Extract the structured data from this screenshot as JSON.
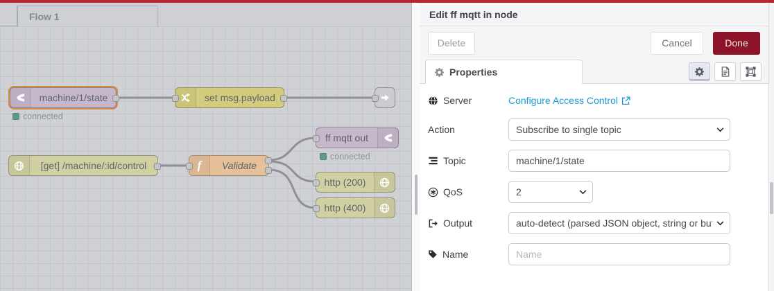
{
  "theme": {
    "brand_red": "#b8242f",
    "done_button_bg": "#8c1328",
    "link_blue": "#1898d5",
    "status_green": "#5f9c86",
    "node_mqtt": "#c6b7cb",
    "node_change": "#d3cc7d",
    "node_http": "#d0d0a2",
    "node_function": "#e5c098",
    "selection_orange": "#d68b43"
  },
  "canvas": {
    "tab": "Flow 1",
    "nodes": [
      {
        "type": "mqtt-in",
        "label": "machine/1/state",
        "status": "connected"
      },
      {
        "type": "change",
        "label": "set msg.payload"
      },
      {
        "type": "link-out",
        "label": ""
      },
      {
        "type": "http-in",
        "label": "[get] /machine/:id/control"
      },
      {
        "type": "function",
        "label": "Validate"
      },
      {
        "type": "mqtt-out",
        "label": "ff mqtt out",
        "status": "connected"
      },
      {
        "type": "http-response",
        "label": "http (200)"
      },
      {
        "type": "http-response",
        "label": "http (400)"
      }
    ]
  },
  "panel": {
    "title": "Edit ff mqtt in node",
    "toolbar": {
      "delete": "Delete",
      "cancel": "Cancel",
      "done": "Done"
    },
    "tab": "Properties",
    "fields": {
      "server": {
        "label": "Server",
        "link_text": "Configure Access Control"
      },
      "action": {
        "label": "Action",
        "value": "Subscribe to single topic"
      },
      "topic": {
        "label": "Topic",
        "value": "machine/1/state"
      },
      "qos": {
        "label": "QoS",
        "value": "2"
      },
      "output": {
        "label": "Output",
        "value": "auto-detect (parsed JSON object, string or buffer)"
      },
      "name": {
        "label": "Name",
        "placeholder": "Name"
      }
    }
  }
}
